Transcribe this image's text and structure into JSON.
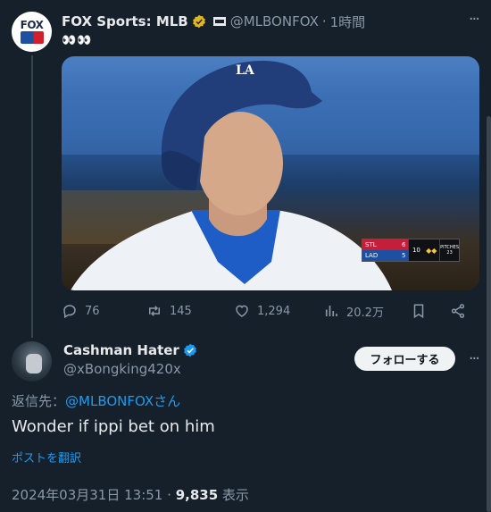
{
  "original_tweet": {
    "author_name": "FOX Sports: MLB",
    "handle": "@MLBONFOX",
    "time": "1時間",
    "emoji_line": "👀👀",
    "avatar_text": "FOX",
    "media": {
      "scorebug": {
        "team1": "STL",
        "score1": "6",
        "team2": "LAD",
        "score2": "5",
        "inning": "10",
        "pitches_label": "PITCHES",
        "pitches": "23"
      }
    },
    "stats": {
      "replies": "76",
      "reposts": "145",
      "likes": "1,294",
      "views": "20.2万"
    }
  },
  "reply": {
    "author_name": "Cashman Hater",
    "handle": "@xBongking420x",
    "follow_label": "フォローする",
    "reply_to_prefix": "返信先：",
    "reply_to_mention": "@MLBONFOXさん",
    "text": "Wonder if ippi bet on him",
    "translate_label": "ポストを翻訳",
    "timestamp": "2024年03月31日 13:51",
    "dot": "·",
    "view_count": "9,835",
    "views_label": "表示"
  },
  "colors": {
    "background": "#15202b",
    "accent": "#1d9bf0",
    "muted": "#8b98a5",
    "verified": "#e2b719"
  }
}
